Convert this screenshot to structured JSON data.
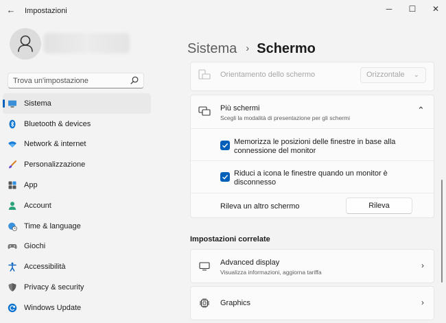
{
  "window": {
    "app_title": "Impostazioni",
    "back_glyph": "←",
    "minimize_glyph": "─",
    "maximize_glyph": "☐",
    "close_glyph": "✕"
  },
  "search": {
    "placeholder": "Trova un'impostazione",
    "icon": "search-icon"
  },
  "sidebar": {
    "items": [
      {
        "label": "Sistema",
        "icon": "monitor-icon",
        "active": true
      },
      {
        "label": "Bluetooth & devices",
        "icon": "bluetooth-icon"
      },
      {
        "label": "Network & internet",
        "icon": "wifi-icon"
      },
      {
        "label": "Personalizzazione",
        "icon": "brush-icon"
      },
      {
        "label": "App",
        "icon": "apps-icon"
      },
      {
        "label": "Account",
        "icon": "person-icon"
      },
      {
        "label": "Time & language",
        "icon": "globe-clock-icon"
      },
      {
        "label": "Giochi",
        "icon": "gamepad-icon"
      },
      {
        "label": "Accessibilità",
        "icon": "accessibility-icon"
      },
      {
        "label": "Privacy & security",
        "icon": "shield-icon"
      },
      {
        "label": "Windows Update",
        "icon": "update-icon"
      }
    ]
  },
  "breadcrumb": {
    "parent": "Sistema",
    "separator": "›",
    "current": "Schermo"
  },
  "orientation": {
    "label": "Orientamento dello schermo",
    "value": "Orizzontale",
    "chevron": "⌄"
  },
  "multi_display": {
    "title": "Più schermi",
    "subtitle": "Scegli la modalità di presentazione per gli schermi",
    "collapse_glyph": "⌃",
    "options": [
      {
        "label_line1": "Memorizza le posizioni delle finestre in base alla",
        "label_line2": "connessione del monitor",
        "checked": true
      },
      {
        "label_line1": "Riduci a icona le finestre quando un monitor è",
        "label_line2": "disconnesso",
        "checked": true
      }
    ],
    "detect_label": "Rileva un altro schermo",
    "detect_button": "Rileva"
  },
  "related": {
    "heading": "Impostazioni correlate",
    "items": [
      {
        "title": "Advanced display",
        "subtitle": "Visualizza informazioni, aggiorna tariffa",
        "icon": "display-icon",
        "chevron": "›"
      },
      {
        "title": "Graphics",
        "subtitle": "",
        "icon": "chip-icon",
        "chevron": "›"
      }
    ]
  },
  "colors": {
    "accent": "#005fb8",
    "background": "#f3f3f3",
    "card": "#fbfbfb"
  }
}
